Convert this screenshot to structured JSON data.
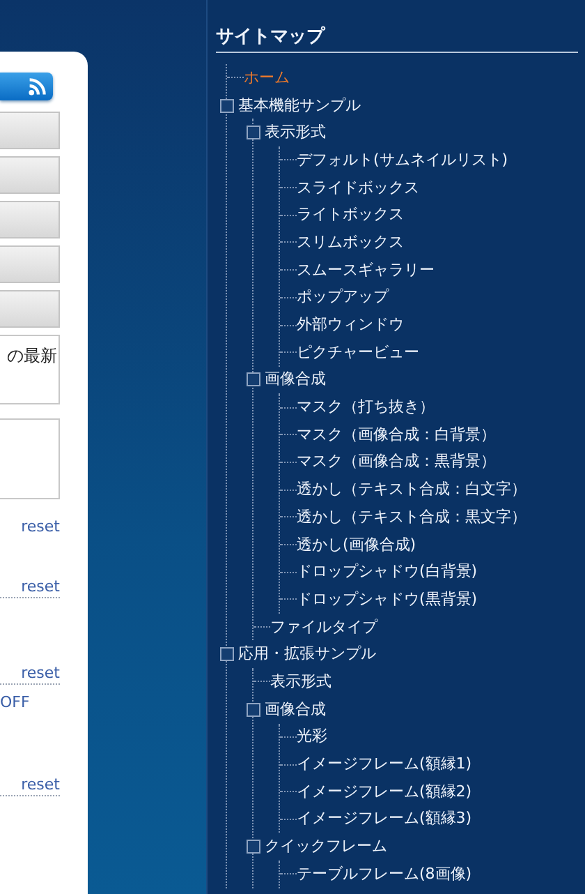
{
  "side_panel": {
    "notice_text": "の最新",
    "links": [
      {
        "kind": "link",
        "label": "reset",
        "ruled": false
      },
      {
        "kind": "link",
        "label": "reset",
        "ruled": true
      },
      {
        "kind": "link",
        "label": "reset",
        "ruled": true
      },
      {
        "kind": "option",
        "label": "OFF",
        "ruled": false
      },
      {
        "kind": "link",
        "label": "reset",
        "ruled": true
      }
    ]
  },
  "sitemap": {
    "title": "サイトマップ",
    "items": [
      {
        "label": "ホーム",
        "selected": true
      },
      {
        "label": "基本機能サンプル",
        "selected": false,
        "children": [
          {
            "label": "表示形式",
            "selected": false,
            "children": [
              {
                "label": "デフォルト(サムネイルリスト)",
                "selected": false
              },
              {
                "label": "スライドボックス",
                "selected": false
              },
              {
                "label": "ライトボックス",
                "selected": false
              },
              {
                "label": "スリムボックス",
                "selected": false
              },
              {
                "label": "スムースギャラリー",
                "selected": false
              },
              {
                "label": "ポップアップ",
                "selected": false
              },
              {
                "label": "外部ウィンドウ",
                "selected": false
              },
              {
                "label": "ピクチャービュー",
                "selected": false
              }
            ]
          },
          {
            "label": "画像合成",
            "selected": false,
            "children": [
              {
                "label": "マスク（打ち抜き）",
                "selected": false
              },
              {
                "label": "マスク（画像合成：白背景）",
                "selected": false
              },
              {
                "label": "マスク（画像合成：黒背景）",
                "selected": false
              },
              {
                "label": "透かし（テキスト合成：白文字）",
                "selected": false
              },
              {
                "label": "透かし（テキスト合成：黒文字）",
                "selected": false
              },
              {
                "label": "透かし(画像合成)",
                "selected": false
              },
              {
                "label": "ドロップシャドウ(白背景)",
                "selected": false
              },
              {
                "label": "ドロップシャドウ(黒背景)",
                "selected": false
              }
            ]
          },
          {
            "label": "ファイルタイプ",
            "selected": false
          }
        ]
      },
      {
        "label": "応用・拡張サンプル",
        "selected": false,
        "children": [
          {
            "label": "表示形式",
            "selected": false
          },
          {
            "label": "画像合成",
            "selected": false,
            "children": [
              {
                "label": "光彩",
                "selected": false
              },
              {
                "label": "イメージフレーム(額縁1)",
                "selected": false
              },
              {
                "label": "イメージフレーム(額縁2)",
                "selected": false
              },
              {
                "label": "イメージフレーム(額縁3)",
                "selected": false
              }
            ]
          },
          {
            "label": "クイックフレーム",
            "selected": false,
            "children": [
              {
                "label": "テーブルフレーム(8画像)",
                "selected": false
              }
            ]
          }
        ]
      }
    ]
  }
}
